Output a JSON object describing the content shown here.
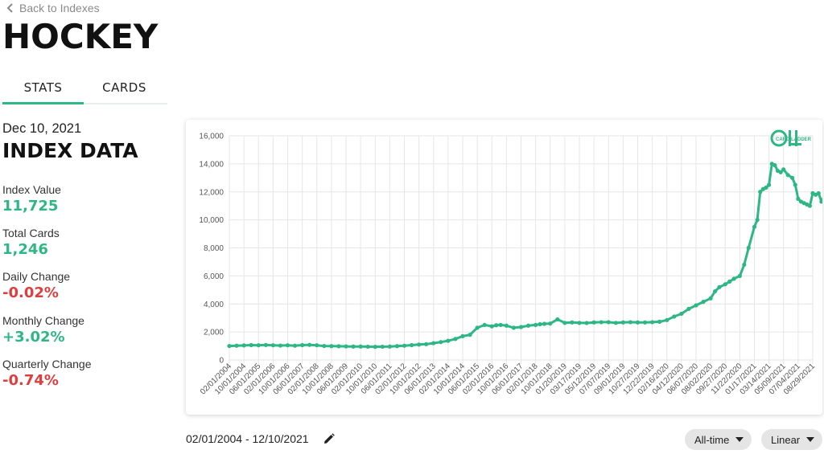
{
  "nav": {
    "back_label": "Back to Indexes"
  },
  "page": {
    "title": "HOCKEY"
  },
  "tabs": [
    {
      "label": "STATS"
    },
    {
      "label": "CARDS"
    }
  ],
  "summary": {
    "date": "Dec 10, 2021",
    "section_title": "INDEX DATA",
    "stats": [
      {
        "label": "Index Value",
        "value": "11,725",
        "tone": "positive"
      },
      {
        "label": "Total Cards",
        "value": "1,246",
        "tone": "positive"
      },
      {
        "label": "Daily Change",
        "value": "-0.02%",
        "tone": "negative"
      },
      {
        "label": "Monthly Change",
        "value": "+3.02%",
        "tone": "positive"
      },
      {
        "label": "Quarterly Change",
        "value": "-0.74%",
        "tone": "negative"
      }
    ]
  },
  "chart_data": {
    "type": "line",
    "title": "",
    "xlabel": "",
    "ylabel": "",
    "ylim": [
      0,
      16000
    ],
    "yticks": [
      0,
      2000,
      4000,
      6000,
      8000,
      10000,
      12000,
      14000,
      16000
    ],
    "ytick_labels": [
      "0",
      "2,000",
      "4,000",
      "6,000",
      "8,000",
      "10,000",
      "12,000",
      "14,000",
      "16,000"
    ],
    "xtick_labels": [
      "02/01/2004",
      "10/01/2004",
      "06/01/2005",
      "02/01/2006",
      "10/01/2006",
      "06/01/2007",
      "02/01/2008",
      "10/01/2008",
      "06/01/2009",
      "02/01/2010",
      "10/01/2010",
      "06/01/2011",
      "02/01/2012",
      "10/01/2012",
      "06/01/2013",
      "02/01/2014",
      "10/01/2014",
      "06/01/2015",
      "02/01/2016",
      "10/01/2016",
      "06/01/2017",
      "02/01/2018",
      "10/01/2018",
      "01/20/2019",
      "03/17/2019",
      "05/12/2019",
      "07/07/2019",
      "09/01/2019",
      "10/27/2019",
      "12/22/2019",
      "02/16/2020",
      "04/12/2020",
      "06/07/2020",
      "08/02/2020",
      "09/27/2020",
      "11/22/2020",
      "01/17/2021",
      "03/14/2021",
      "05/09/2021",
      "07/04/2021",
      "08/29/2021"
    ],
    "series": [
      {
        "color": "#2db784",
        "x_index": [
          0,
          0.5,
          1,
          1.5,
          2,
          2.5,
          3,
          3.5,
          4,
          4.5,
          5,
          5.5,
          6,
          6.5,
          7,
          7.5,
          8,
          8.5,
          9,
          9.5,
          10,
          10.5,
          11,
          11.5,
          12,
          12.5,
          13,
          13.5,
          14,
          14.5,
          15,
          15.5,
          16,
          16.5,
          17,
          17.5,
          18,
          18.3,
          18.6,
          19,
          19.5,
          20,
          20.5,
          21,
          21.3,
          21.6,
          22,
          22.5,
          23,
          23.5,
          24,
          24.5,
          25,
          25.5,
          26,
          26.5,
          27,
          27.5,
          28,
          28.5,
          29,
          29.5,
          30,
          30.5,
          31,
          31.5,
          32,
          32.5,
          33,
          33.3,
          33.6,
          34,
          34.3,
          34.6,
          35,
          35.3,
          35.6,
          36,
          36.2,
          36.4,
          36.6,
          36.8,
          37,
          37.2,
          37.4,
          37.6,
          37.8,
          38,
          38.3,
          38.6,
          38.8,
          39,
          39.2,
          39.4,
          39.6,
          39.8,
          40,
          40.2,
          40.4,
          40.6,
          40.8
        ],
        "values": [
          1000,
          1020,
          1040,
          1060,
          1050,
          1070,
          1050,
          1030,
          1050,
          1020,
          1060,
          1080,
          1050,
          1000,
          990,
          980,
          970,
          960,
          960,
          950,
          940,
          950,
          960,
          990,
          1020,
          1060,
          1100,
          1130,
          1200,
          1280,
          1370,
          1500,
          1700,
          1800,
          2300,
          2500,
          2400,
          2480,
          2500,
          2450,
          2300,
          2350,
          2450,
          2500,
          2550,
          2580,
          2600,
          2900,
          2650,
          2680,
          2650,
          2640,
          2680,
          2700,
          2700,
          2650,
          2680,
          2700,
          2680,
          2680,
          2700,
          2730,
          2850,
          3100,
          3300,
          3650,
          3900,
          4150,
          4400,
          4900,
          5200,
          5400,
          5600,
          5800,
          6000,
          6800,
          8000,
          9500,
          10000,
          12000,
          12200,
          12300,
          12500,
          14000,
          13900,
          13500,
          13400,
          13600,
          13200,
          13000,
          12500,
          11500,
          11300,
          11200,
          11100,
          11000,
          11900,
          11800,
          11900,
          11300,
          11725
        ]
      }
    ],
    "date_range": "02/01/2004 - 12/10/2021"
  },
  "watermark": {
    "text": "CARD LADDER"
  },
  "controls": {
    "time_range": "All-time",
    "scale": "Linear"
  }
}
